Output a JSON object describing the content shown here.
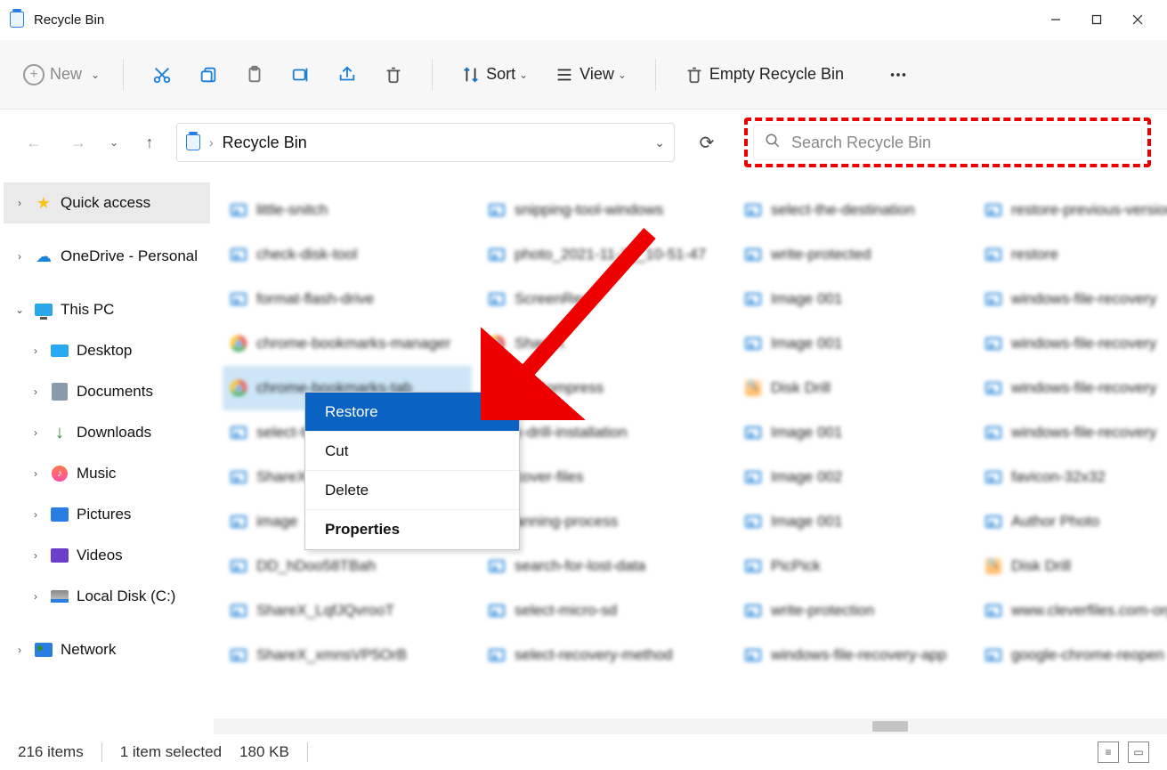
{
  "window": {
    "title": "Recycle Bin"
  },
  "ribbon": {
    "new_label": "New",
    "sort_label": "Sort",
    "view_label": "View",
    "empty_label": "Empty Recycle Bin"
  },
  "address": {
    "location": "Recycle Bin"
  },
  "search": {
    "placeholder": "Search Recycle Bin"
  },
  "tree": {
    "quick_access": "Quick access",
    "onedrive": "OneDrive - Personal",
    "this_pc": "This PC",
    "desktop": "Desktop",
    "documents": "Documents",
    "downloads": "Downloads",
    "music": "Music",
    "pictures": "Pictures",
    "videos": "Videos",
    "local_disk": "Local Disk (C:)",
    "network": "Network"
  },
  "files": {
    "col1": [
      "little-snitch",
      "check-disk-tool",
      "format-flash-drive",
      "chrome-bookmarks-manager",
      "chrome-bookmarks-tab",
      "select-the",
      "ShareX",
      "image",
      "DD_hDoo58TBah",
      "ShareX_LqfJQvrooT",
      "ShareX_xmnsVP5OrB"
    ],
    "col2": [
      "snipping-tool-windows",
      "photo_2021-11-1__10-51-47",
      "ScreenRec",
      "ShareX",
      "tchCompress",
      "k-drill-installation",
      "cover-files",
      "anning-process",
      "search-for-lost-data",
      "select-micro-sd",
      "select-recovery-method"
    ],
    "col3": [
      "select-the-destination",
      "write-protected",
      "Image 001",
      "Image 001",
      "Disk Drill",
      "Image 001",
      "Image 002",
      "Image 001",
      "PicPick",
      "write-protection",
      "windows-file-recovery-app"
    ],
    "col4": [
      "restore-previous-version",
      "restore",
      "windows-file-recovery",
      "windows-file-recovery",
      "windows-file-recovery",
      "windows-file-recovery",
      "favicon-32x32",
      "Author Photo",
      "Disk Drill",
      "www.cleverfiles.com-org",
      "google-chrome-reopen"
    ]
  },
  "context_menu": {
    "restore": "Restore",
    "cut": "Cut",
    "delete": "Delete",
    "properties": "Properties"
  },
  "status": {
    "items": "216 items",
    "selected": "1 item selected",
    "size": "180 KB"
  }
}
